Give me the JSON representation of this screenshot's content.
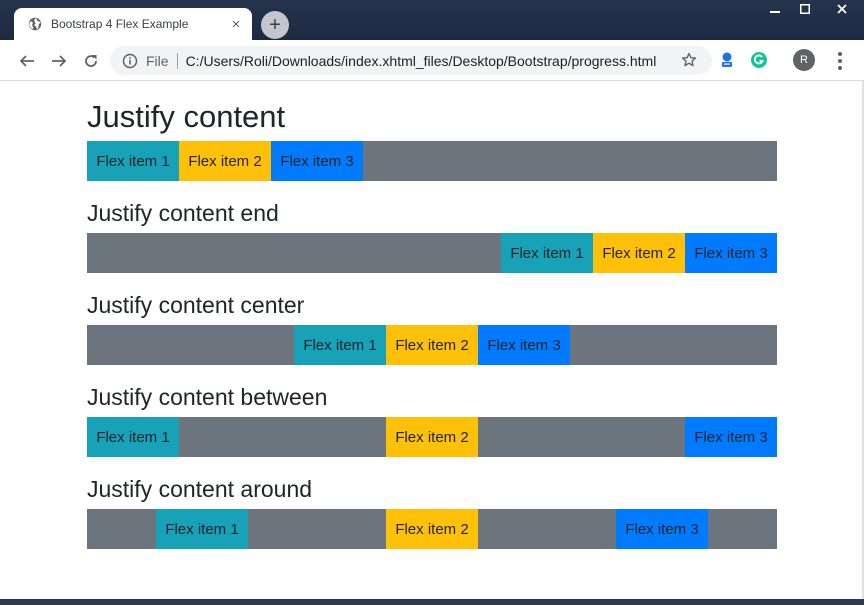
{
  "browser": {
    "tab_title": "Bootstrap 4 Flex Example",
    "tab_close": "×",
    "new_tab": "+",
    "scheme": "File",
    "url": "C:/Users/Roli/Downloads/index.xhtml_files/Desktop/Bootstrap/progress.html",
    "avatar_letter": "R",
    "icons": [
      "globe-icon",
      "close-icon",
      "plus-icon",
      "back-icon",
      "forward-icon",
      "reload-icon",
      "info-icon",
      "star-icon",
      "extension-icon",
      "grammarly-icon",
      "menu-icon",
      "minimize-icon",
      "maximize-icon"
    ],
    "colors": {
      "frame": "#26334d",
      "toolbar": "#ffffff",
      "omnibox": "#f1f3f4"
    }
  },
  "page": {
    "sections": [
      {
        "heading": "Justify content",
        "justify": "start",
        "items": [
          "Flex item 1",
          "Flex item 2",
          "Flex item 3"
        ]
      },
      {
        "heading": "Justify content end",
        "justify": "end",
        "items": [
          "Flex item 1",
          "Flex item 2",
          "Flex item 3"
        ]
      },
      {
        "heading": "Justify content center",
        "justify": "center",
        "items": [
          "Flex item 1",
          "Flex item 2",
          "Flex item 3"
        ]
      },
      {
        "heading": "Justify content between",
        "justify": "between",
        "items": [
          "Flex item 1",
          "Flex item 2",
          "Flex item 3"
        ]
      },
      {
        "heading": "Justify content around",
        "justify": "around",
        "items": [
          "Flex item 1",
          "Flex item 2",
          "Flex item 3"
        ]
      }
    ],
    "colors": {
      "container_bg": "#6c757d",
      "info": "#17a2b8",
      "warning": "#ffc107",
      "primary": "#007bff"
    }
  }
}
